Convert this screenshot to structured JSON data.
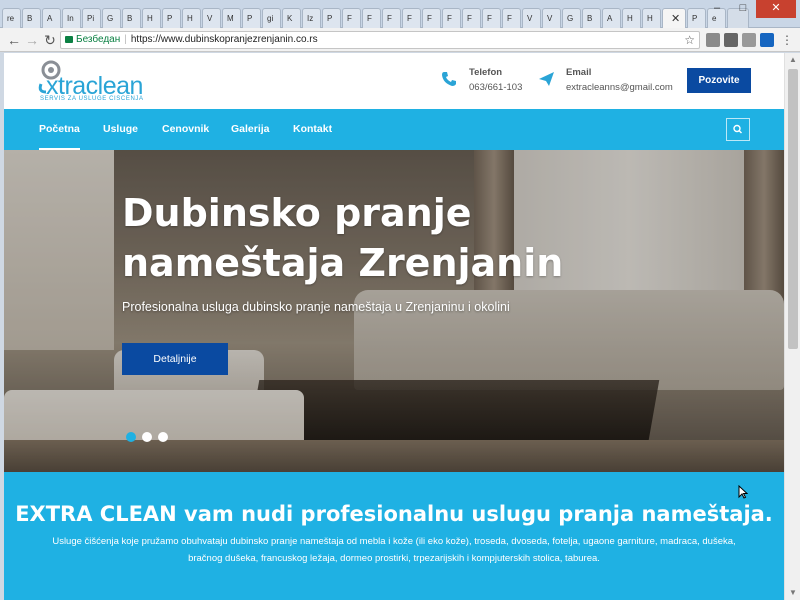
{
  "browser": {
    "tabs": [
      "re",
      "B",
      "A",
      "In",
      "Pi",
      "G",
      "B",
      "H",
      "P",
      "H",
      "V",
      "M",
      "P",
      "gi",
      "K",
      "Iz",
      "P",
      "F",
      "F",
      "F",
      "F",
      "F",
      "F",
      "F",
      "F",
      "F",
      "V",
      "V",
      "G",
      "B",
      "A",
      "H",
      "H",
      "✕",
      "P",
      "e"
    ],
    "window_controls": {
      "minimize": "–",
      "maximize": "□",
      "close": "✕"
    },
    "back_icon": "←",
    "forward_icon": "→",
    "reload_icon": "↻",
    "secure_label": "Безбедан",
    "url": "https://www.dubinskopranjezrenjanin.co.rs",
    "star_icon": "☆"
  },
  "header": {
    "logo_text": "xtraclean",
    "logo_subtitle": "SERVIS ZA USLUGE CISCENJA",
    "phone_title": "Telefon",
    "phone_value": "063/661-103",
    "email_title": "Email",
    "email_value": "extracleanns@gmail.com",
    "call_button": "Pozovite"
  },
  "nav": {
    "items": [
      "Početna",
      "Usluge",
      "Cenovnik",
      "Galerija",
      "Kontakt"
    ],
    "active_index": 0
  },
  "hero": {
    "title": "Dubinsko pranje nameštaja Zrenjanin",
    "subtitle": "Profesionalna usluga dubinsko pranje nameštaja u Zrenjaninu i okolini",
    "button": "Detaljnije",
    "slides": 3,
    "active_slide": 0
  },
  "intro": {
    "title": "EXTRA CLEAN vam nudi profesionalnu uslugu pranja nameštaja.",
    "text": "Usluge čišćenja koje pružamo obuhvataju dubinsko pranje nameštaja od mebla i kože (ili eko kože), troseda, dvoseda, fotelja, ugaone garniture, madraca, dušeka, bračnog dušeka, francuskog ležaja, dormeo prostirki, trpezarijskih i kompjuterskih stolica, taburea."
  },
  "colors": {
    "brand_cyan": "#1fb1e3",
    "brand_blue": "#0a4aa1"
  }
}
